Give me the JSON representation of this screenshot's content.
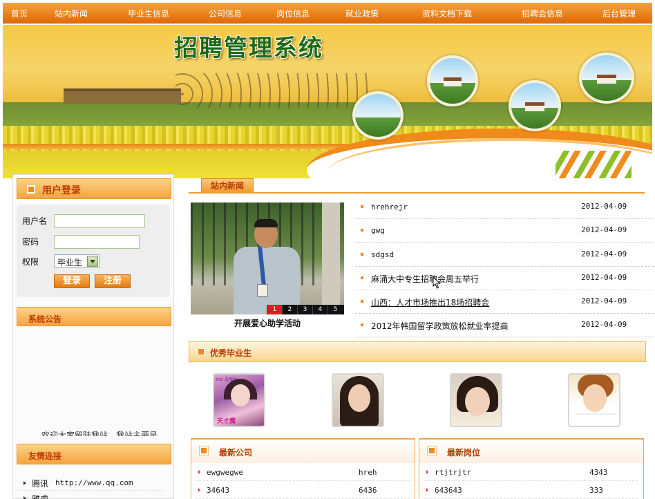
{
  "nav": [
    "首页",
    "站内新闻",
    "毕业生信息",
    "公司信息",
    "岗位信息",
    "就业政策",
    "资料文档下载",
    "招聘会信息",
    "后台管理"
  ],
  "banner": {
    "title": "招聘管理系统"
  },
  "login": {
    "title": "用户登录",
    "username_label": "用户名",
    "password_label": "密码",
    "role_label": "权限",
    "role_value": "毕业生",
    "login_button": "登录",
    "register_button": "注册"
  },
  "notice": {
    "title": "系统公告",
    "scroll_text": "欢迎大家留陆我站，我站主要是"
  },
  "links": {
    "title": "友情连接",
    "items": [
      {
        "name": "腾讯",
        "url": "http://www.qq.com"
      },
      {
        "name": "雅虎",
        "url": "..."
      }
    ]
  },
  "news": {
    "tab": "站内新闻",
    "photo_caption": "开展爱心助学活动",
    "pager": [
      "1",
      "2",
      "3",
      "4",
      "5"
    ],
    "items": [
      {
        "title": "hrehrejr",
        "date": "2012-04-09"
      },
      {
        "title": "gwg",
        "date": "2012-04-09"
      },
      {
        "title": "sdgsd",
        "date": "2012-04-09"
      },
      {
        "title": "麻涌大中专生招聘会周五举行",
        "date": "2012-04-09"
      },
      {
        "title": "山西：人才市场推出18场招聘会",
        "date": "2012-04-09"
      },
      {
        "title": "2012年韩国留学政策放松就业率提高",
        "date": "2012-04-09"
      }
    ]
  },
  "graduates": {
    "title": "优秀毕业生",
    "avatar1_tag": "kid 永恒*",
    "avatar1_caption": "天才魔"
  },
  "companies": {
    "title": "最新公司",
    "rows": [
      {
        "name": "ewgwegwe",
        "value": "hreh"
      },
      {
        "name": "34643",
        "value": "6436"
      }
    ]
  },
  "positions": {
    "title": "最新岗位",
    "rows": [
      {
        "name": "rtjtrjtr",
        "value": "4343"
      },
      {
        "name": "643643",
        "value": "333"
      }
    ]
  },
  "colors": {
    "accent": "#f29a2e",
    "nav_bg": "#e06a06",
    "title_red": "#c23a00"
  }
}
